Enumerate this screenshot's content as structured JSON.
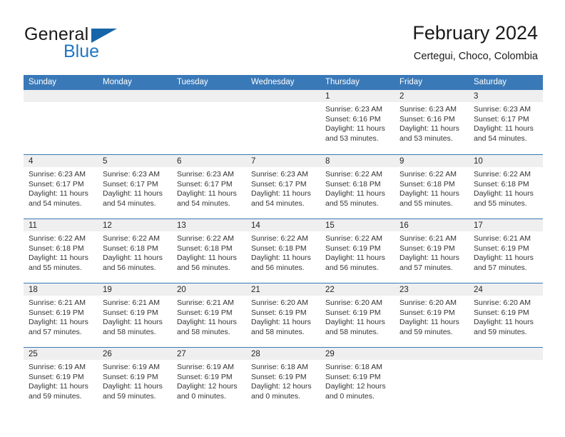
{
  "brand": {
    "name_part1": "General",
    "name_part2": "Blue",
    "flag_icon": "blue-triangle-flag-icon",
    "accent_color": "#2076c4"
  },
  "header": {
    "title": "February 2024",
    "subtitle": "Certegui, Choco, Colombia"
  },
  "theme": {
    "header_blue": "#3a79b8",
    "day_band_gray": "#efefef",
    "text_color": "#333333"
  },
  "weekdays": [
    "Sunday",
    "Monday",
    "Tuesday",
    "Wednesday",
    "Thursday",
    "Friday",
    "Saturday"
  ],
  "weeks": [
    [
      {
        "day": "",
        "lines": []
      },
      {
        "day": "",
        "lines": []
      },
      {
        "day": "",
        "lines": []
      },
      {
        "day": "",
        "lines": []
      },
      {
        "day": "1",
        "lines": [
          "Sunrise: 6:23 AM",
          "Sunset: 6:16 PM",
          "Daylight: 11 hours",
          "and 53 minutes."
        ]
      },
      {
        "day": "2",
        "lines": [
          "Sunrise: 6:23 AM",
          "Sunset: 6:16 PM",
          "Daylight: 11 hours",
          "and 53 minutes."
        ]
      },
      {
        "day": "3",
        "lines": [
          "Sunrise: 6:23 AM",
          "Sunset: 6:17 PM",
          "Daylight: 11 hours",
          "and 54 minutes."
        ]
      }
    ],
    [
      {
        "day": "4",
        "lines": [
          "Sunrise: 6:23 AM",
          "Sunset: 6:17 PM",
          "Daylight: 11 hours",
          "and 54 minutes."
        ]
      },
      {
        "day": "5",
        "lines": [
          "Sunrise: 6:23 AM",
          "Sunset: 6:17 PM",
          "Daylight: 11 hours",
          "and 54 minutes."
        ]
      },
      {
        "day": "6",
        "lines": [
          "Sunrise: 6:23 AM",
          "Sunset: 6:17 PM",
          "Daylight: 11 hours",
          "and 54 minutes."
        ]
      },
      {
        "day": "7",
        "lines": [
          "Sunrise: 6:23 AM",
          "Sunset: 6:17 PM",
          "Daylight: 11 hours",
          "and 54 minutes."
        ]
      },
      {
        "day": "8",
        "lines": [
          "Sunrise: 6:22 AM",
          "Sunset: 6:18 PM",
          "Daylight: 11 hours",
          "and 55 minutes."
        ]
      },
      {
        "day": "9",
        "lines": [
          "Sunrise: 6:22 AM",
          "Sunset: 6:18 PM",
          "Daylight: 11 hours",
          "and 55 minutes."
        ]
      },
      {
        "day": "10",
        "lines": [
          "Sunrise: 6:22 AM",
          "Sunset: 6:18 PM",
          "Daylight: 11 hours",
          "and 55 minutes."
        ]
      }
    ],
    [
      {
        "day": "11",
        "lines": [
          "Sunrise: 6:22 AM",
          "Sunset: 6:18 PM",
          "Daylight: 11 hours",
          "and 55 minutes."
        ]
      },
      {
        "day": "12",
        "lines": [
          "Sunrise: 6:22 AM",
          "Sunset: 6:18 PM",
          "Daylight: 11 hours",
          "and 56 minutes."
        ]
      },
      {
        "day": "13",
        "lines": [
          "Sunrise: 6:22 AM",
          "Sunset: 6:18 PM",
          "Daylight: 11 hours",
          "and 56 minutes."
        ]
      },
      {
        "day": "14",
        "lines": [
          "Sunrise: 6:22 AM",
          "Sunset: 6:18 PM",
          "Daylight: 11 hours",
          "and 56 minutes."
        ]
      },
      {
        "day": "15",
        "lines": [
          "Sunrise: 6:22 AM",
          "Sunset: 6:19 PM",
          "Daylight: 11 hours",
          "and 56 minutes."
        ]
      },
      {
        "day": "16",
        "lines": [
          "Sunrise: 6:21 AM",
          "Sunset: 6:19 PM",
          "Daylight: 11 hours",
          "and 57 minutes."
        ]
      },
      {
        "day": "17",
        "lines": [
          "Sunrise: 6:21 AM",
          "Sunset: 6:19 PM",
          "Daylight: 11 hours",
          "and 57 minutes."
        ]
      }
    ],
    [
      {
        "day": "18",
        "lines": [
          "Sunrise: 6:21 AM",
          "Sunset: 6:19 PM",
          "Daylight: 11 hours",
          "and 57 minutes."
        ]
      },
      {
        "day": "19",
        "lines": [
          "Sunrise: 6:21 AM",
          "Sunset: 6:19 PM",
          "Daylight: 11 hours",
          "and 58 minutes."
        ]
      },
      {
        "day": "20",
        "lines": [
          "Sunrise: 6:21 AM",
          "Sunset: 6:19 PM",
          "Daylight: 11 hours",
          "and 58 minutes."
        ]
      },
      {
        "day": "21",
        "lines": [
          "Sunrise: 6:20 AM",
          "Sunset: 6:19 PM",
          "Daylight: 11 hours",
          "and 58 minutes."
        ]
      },
      {
        "day": "22",
        "lines": [
          "Sunrise: 6:20 AM",
          "Sunset: 6:19 PM",
          "Daylight: 11 hours",
          "and 58 minutes."
        ]
      },
      {
        "day": "23",
        "lines": [
          "Sunrise: 6:20 AM",
          "Sunset: 6:19 PM",
          "Daylight: 11 hours",
          "and 59 minutes."
        ]
      },
      {
        "day": "24",
        "lines": [
          "Sunrise: 6:20 AM",
          "Sunset: 6:19 PM",
          "Daylight: 11 hours",
          "and 59 minutes."
        ]
      }
    ],
    [
      {
        "day": "25",
        "lines": [
          "Sunrise: 6:19 AM",
          "Sunset: 6:19 PM",
          "Daylight: 11 hours",
          "and 59 minutes."
        ]
      },
      {
        "day": "26",
        "lines": [
          "Sunrise: 6:19 AM",
          "Sunset: 6:19 PM",
          "Daylight: 11 hours",
          "and 59 minutes."
        ]
      },
      {
        "day": "27",
        "lines": [
          "Sunrise: 6:19 AM",
          "Sunset: 6:19 PM",
          "Daylight: 12 hours",
          "and 0 minutes."
        ]
      },
      {
        "day": "28",
        "lines": [
          "Sunrise: 6:18 AM",
          "Sunset: 6:19 PM",
          "Daylight: 12 hours",
          "and 0 minutes."
        ]
      },
      {
        "day": "29",
        "lines": [
          "Sunrise: 6:18 AM",
          "Sunset: 6:19 PM",
          "Daylight: 12 hours",
          "and 0 minutes."
        ]
      },
      {
        "day": "",
        "lines": []
      },
      {
        "day": "",
        "lines": []
      }
    ]
  ]
}
